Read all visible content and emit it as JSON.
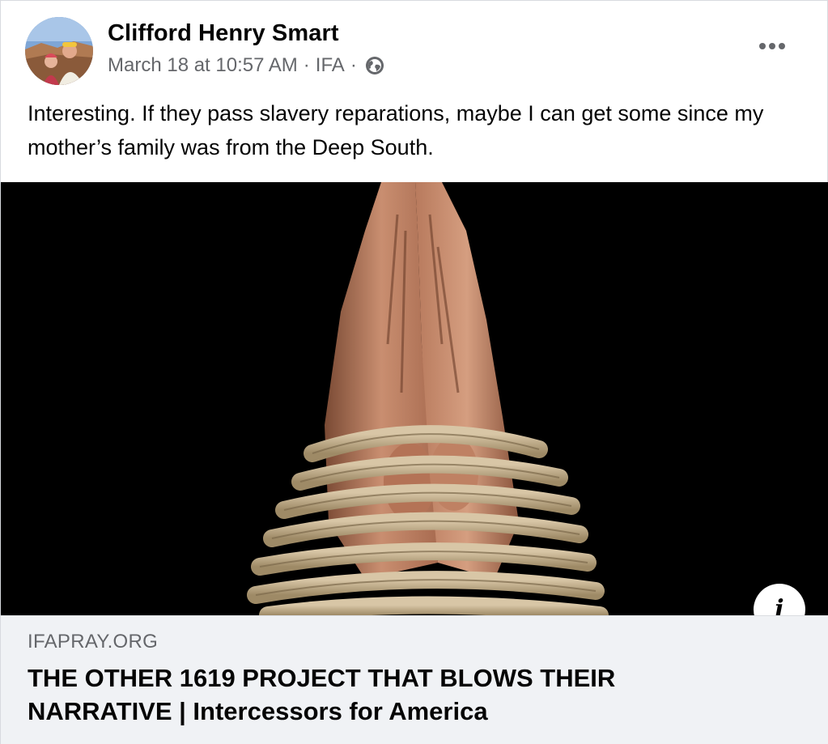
{
  "post": {
    "author_name": "Clifford Henry Smart",
    "timestamp": "March 18 at 10:57 AM",
    "group": "IFA",
    "separator": "·",
    "privacy_icon": "globe-icon",
    "more_icon": "more-options-icon",
    "text": "Interesting. If they pass slavery reparations, maybe I can get some since my mother’s family was from the Deep South."
  },
  "link_preview": {
    "image_description_icon": "praying-hands-bound-in-rope-image",
    "info_label": "i",
    "domain": "IFAPRAY.ORG",
    "title": "THE OTHER 1619 PROJECT THAT BLOWS THEIR NARRATIVE | Intercessors for America"
  },
  "colors": {
    "text_primary": "#050505",
    "text_secondary": "#65676b",
    "footer_bg": "#f0f2f5",
    "image_bg": "#000000"
  }
}
